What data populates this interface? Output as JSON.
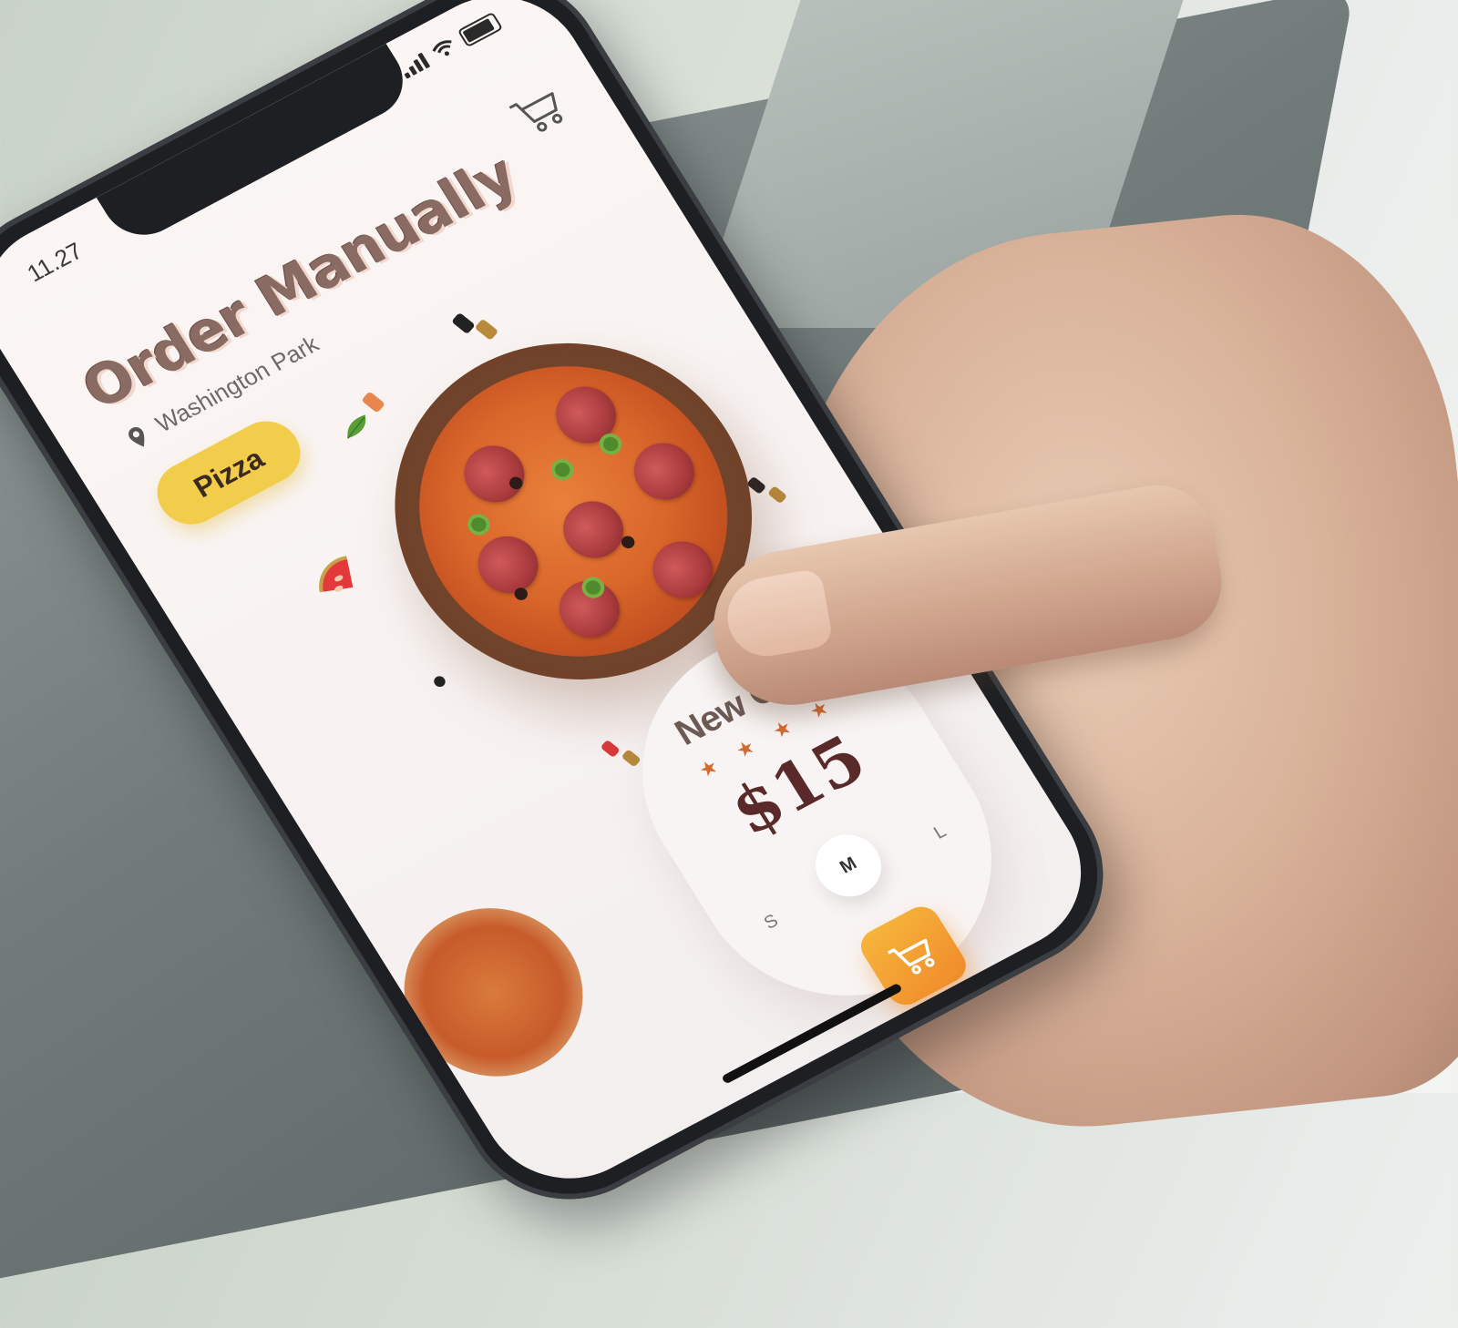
{
  "status_bar": {
    "time": "11.27"
  },
  "header": {
    "title": "Order Manually",
    "location": "Washington Park"
  },
  "category": {
    "label": "Pizza"
  },
  "product": {
    "name": "New Orle",
    "stars": "★ ★ ★ ★",
    "price": "$15",
    "rating": 4
  },
  "sizes": {
    "small": "S",
    "medium": "M",
    "large": "L",
    "selected": "M"
  },
  "colors": {
    "accent_yellow": "#f2cd4b",
    "accent_orange": "#f08a2a",
    "title_brown": "#8a6b63",
    "price_maroon": "#5a2a2a"
  },
  "icons": {
    "cart_top": "cart-icon",
    "location": "pin-icon",
    "add_to_cart": "cart-icon"
  }
}
